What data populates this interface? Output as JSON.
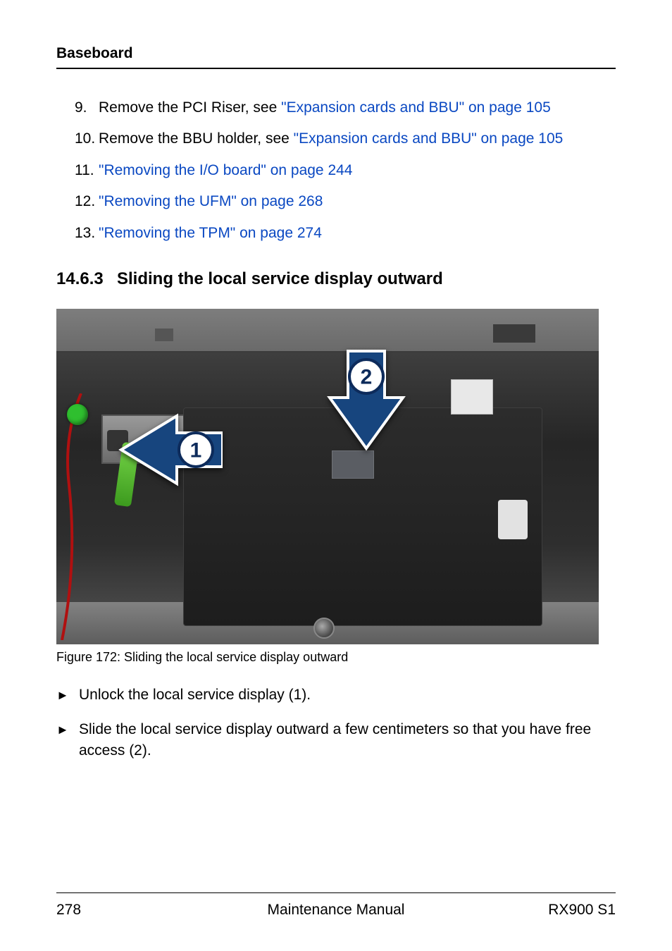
{
  "header": {
    "section": "Baseboard"
  },
  "steps": [
    {
      "n": "9.",
      "prefix": "Remove the PCI Riser, see ",
      "link": "\"Expansion cards and BBU\" on page 105"
    },
    {
      "n": "10.",
      "prefix": "Remove the BBU holder, see ",
      "link": "\"Expansion cards and BBU\" on page 105"
    },
    {
      "n": "11.",
      "prefix": "",
      "link": "\"Removing the I/O board\" on page 244"
    },
    {
      "n": "12.",
      "prefix": "",
      "link": "\"Removing the UFM\" on page 268"
    },
    {
      "n": "13.",
      "prefix": "",
      "link": "\"Removing the TPM\" on page 274"
    }
  ],
  "section": {
    "number": "14.6.3",
    "title": "Sliding the local service display outward"
  },
  "figure": {
    "arrow1_num": "1",
    "arrow2_num": "2",
    "caption": "Figure 172: Sliding the local service display outward"
  },
  "actions": [
    "Unlock the local service display (1).",
    "Slide the local service display outward a few centimeters so that you have free access (2)."
  ],
  "footer": {
    "page": "278",
    "center": "Maintenance Manual",
    "right": "RX900 S1"
  }
}
